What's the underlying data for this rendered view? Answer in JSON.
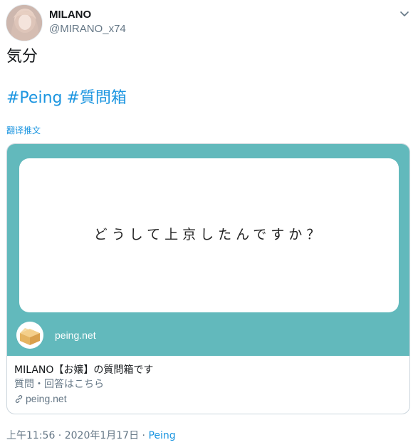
{
  "author": {
    "display_name": "MILANO",
    "handle": "@MIRANO_x74"
  },
  "tweet": {
    "text": "気分",
    "hashtags": [
      "#Peing",
      "#質問箱"
    ],
    "translate_label": "翻译推文"
  },
  "card": {
    "question": "どうして上京したんですか？",
    "site_name": "peing.net",
    "title": "MILANO【お嬢】の質問箱です",
    "description": "質問・回答はこちら",
    "domain": "peing.net",
    "image_bg_color": "#62b9bc"
  },
  "footer": {
    "time": "上午11:56",
    "separator1": " · ",
    "date": "2020年1月17日",
    "separator2": " · ",
    "source": "Peing"
  },
  "icons": {
    "caret": "chevron-down-icon",
    "link": "link-icon",
    "site_logo": "cardboard-box-icon"
  },
  "colors": {
    "link_blue": "#1b95e0",
    "secondary_text": "#657786",
    "card_teal": "#62b9bc"
  }
}
